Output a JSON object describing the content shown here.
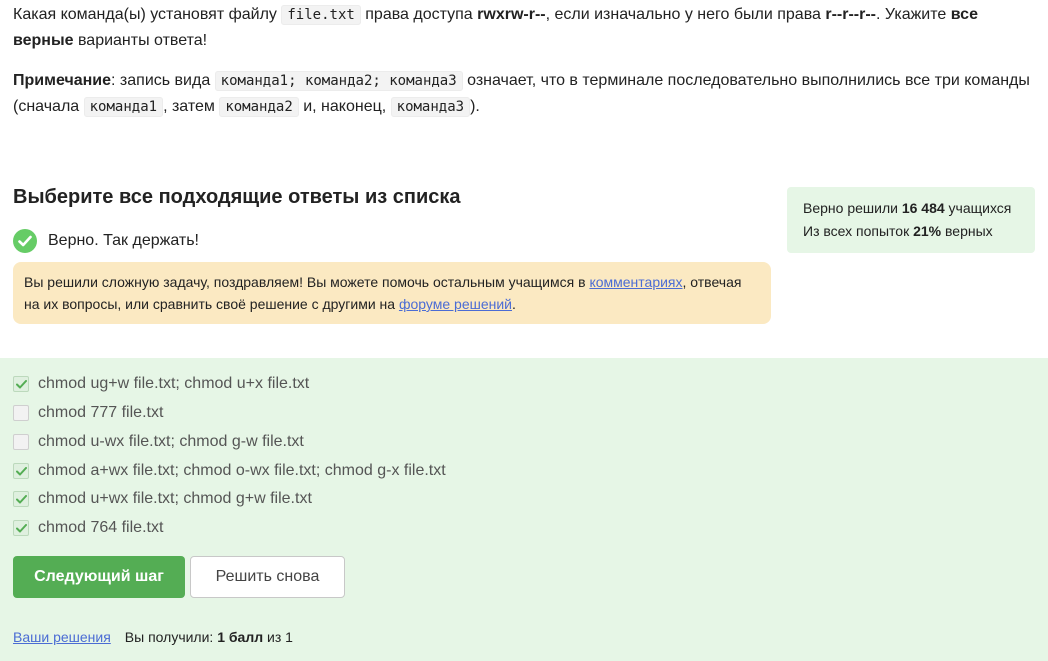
{
  "question": {
    "line1_a": "Какая команда(ы) установят файлу ",
    "code_file": "file.txt",
    "line1_b": " права доступа ",
    "perm_target": "rwxrw-r--",
    "line1_c": ", если изначально у него были права ",
    "perm_initial": "r--r--r--",
    "line1_d": ". Укажите ",
    "bold_all": "все верные",
    "line1_e": " варианты ответа!",
    "note_label": "Примечание",
    "note_a": ": запись вида ",
    "note_code": "команда1; команда2; команда3",
    "note_b": " означает, что в терминале последовательно выполнились все три команды (сначала ",
    "note_code1": "команда1",
    "note_c": ", затем ",
    "note_code2": "команда2",
    "note_d": " и, наконец, ",
    "note_code3": "команда3",
    "note_e": ")."
  },
  "section_title": "Выберите все подходящие ответы из списка",
  "verdict": "Верно. Так держать!",
  "hint": {
    "a": "Вы решили сложную задачу, поздравляем! Вы можете помочь остальным учащимся в ",
    "link_comments": "комментариях",
    "b": ", отвечая на их вопросы, или сравнить своё решение с другими на ",
    "link_forum": "форуме решений",
    "c": "."
  },
  "stats": {
    "solved_prefix": "Верно решили ",
    "solved_count": "16 484",
    "solved_suffix": " учащихся",
    "attempts_prefix": "Из всех попыток ",
    "attempts_percent": "21%",
    "attempts_suffix": " верных"
  },
  "options": [
    {
      "label": "chmod ug+w file.txt; chmod u+x file.txt",
      "checked": true
    },
    {
      "label": "chmod 777 file.txt",
      "checked": false
    },
    {
      "label": "chmod u-wx file.txt; chmod g-w file.txt",
      "checked": false
    },
    {
      "label": "chmod a+wx file.txt; chmod o-wx file.txt; chmod g-x file.txt",
      "checked": true
    },
    {
      "label": "chmod u+wx file.txt; chmod g+w file.txt",
      "checked": true
    },
    {
      "label": "chmod 764 file.txt",
      "checked": true
    }
  ],
  "buttons": {
    "next": "Следующий шаг",
    "retry": "Решить снова"
  },
  "footer": {
    "your_solutions": "Ваши решения",
    "received_prefix": "Вы получили: ",
    "score": "1 балл",
    "received_suffix": " из 1"
  },
  "colors": {
    "accent_green": "#54ad54",
    "success_icon": "#66cc66",
    "answers_bg": "#e6f6e6",
    "hint_bg": "#fbe9c2",
    "link": "#4b6cd4"
  }
}
